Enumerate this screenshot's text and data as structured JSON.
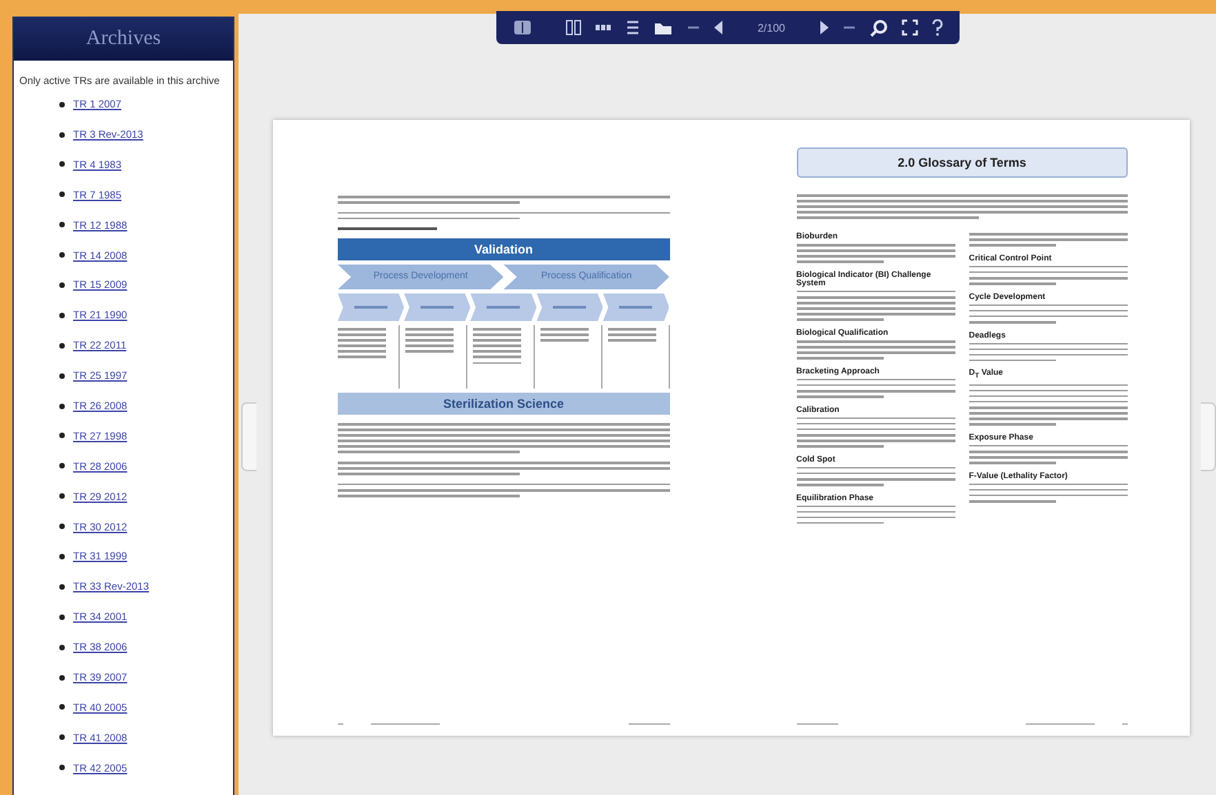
{
  "sidebar": {
    "title": "Archives",
    "note": "Only active TRs are available in this archive",
    "links": [
      "TR 1 2007",
      "TR 3 Rev-2013",
      "TR 4 1983",
      "TR 7 1985",
      "TR 12 1988",
      "TR 14 2008",
      "TR 15 2009",
      "TR 21 1990",
      "TR 22 2011",
      "TR 25 1997",
      "TR 26 2008",
      "TR 27 1998",
      "TR 28 2006",
      "TR 29 2012",
      "TR 30 2012",
      "TR 31 1999",
      "TR 33 Rev-2013",
      "TR 34 2001",
      "TR 38 2006",
      "TR 39 2007",
      "TR 40 2005",
      "TR 41 2008",
      "TR 42 2005"
    ]
  },
  "toolbar": {
    "page": "2/100"
  },
  "left_page": {
    "diagram": {
      "top": "Validation",
      "phases": [
        "Process Development",
        "Process Qualification"
      ],
      "bottom": "Sterilization Science"
    }
  },
  "right_page": {
    "heading": "2.0  Glossary of Terms",
    "column_1": [
      "Bioburden",
      "Biological Indicator (BI) Challenge System",
      "Biological Qualification",
      "Bracketing Approach",
      "Calibration",
      "Cold Spot",
      "Equilibration Phase"
    ],
    "column_2": [
      "Critical Control Point",
      "Cycle Development",
      "Deadlegs",
      "D$_{T}$ Value",
      "Exposure Phase",
      "F-Value (Lethality Factor)"
    ]
  }
}
